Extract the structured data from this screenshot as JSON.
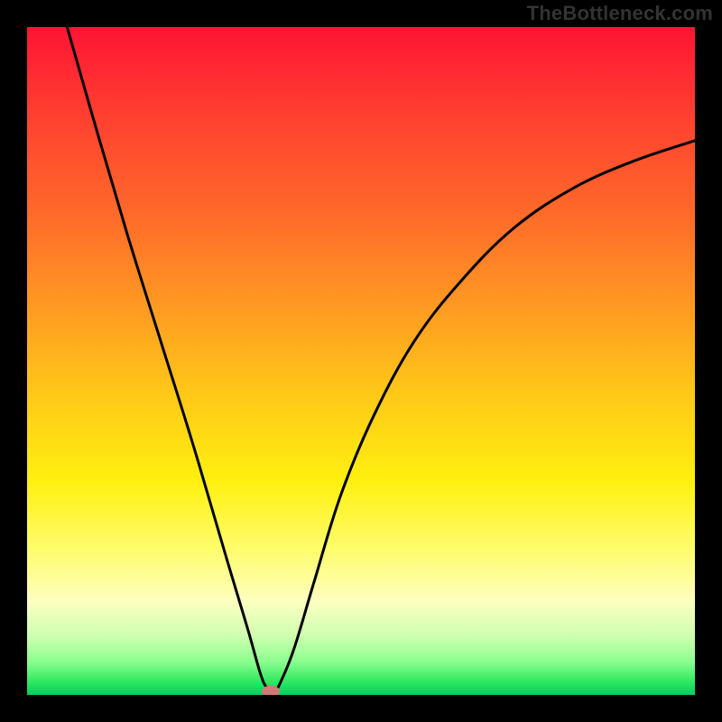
{
  "watermark": "TheBottleneck.com",
  "chart_data": {
    "type": "line",
    "title": "",
    "xlabel": "",
    "ylabel": "",
    "xlim": [
      0,
      100
    ],
    "ylim": [
      0,
      100
    ],
    "background": {
      "type": "vertical-gradient",
      "stops": [
        {
          "pos": 0,
          "color": "#ff1434",
          "meaning": "very high bottleneck"
        },
        {
          "pos": 50,
          "color": "#ffc818",
          "meaning": "moderate"
        },
        {
          "pos": 85,
          "color": "#fdffc0",
          "meaning": "low"
        },
        {
          "pos": 100,
          "color": "#00d060",
          "meaning": "optimal"
        }
      ]
    },
    "series": [
      {
        "name": "bottleneck-curve",
        "color": "#000000",
        "x": [
          6,
          10,
          15,
          20,
          25,
          30,
          33,
          35,
          36,
          37,
          38,
          40,
          43,
          47,
          52,
          58,
          65,
          73,
          82,
          91,
          100
        ],
        "y": [
          100,
          86,
          69,
          53,
          37,
          20,
          10,
          3,
          1,
          0.5,
          2,
          7,
          17,
          30,
          42,
          53,
          62,
          70,
          76,
          80,
          83
        ]
      }
    ],
    "annotations": [
      {
        "name": "optimal-marker",
        "shape": "pill",
        "color": "#cf7a78",
        "x": 36.5,
        "y": 0.5
      }
    ]
  }
}
